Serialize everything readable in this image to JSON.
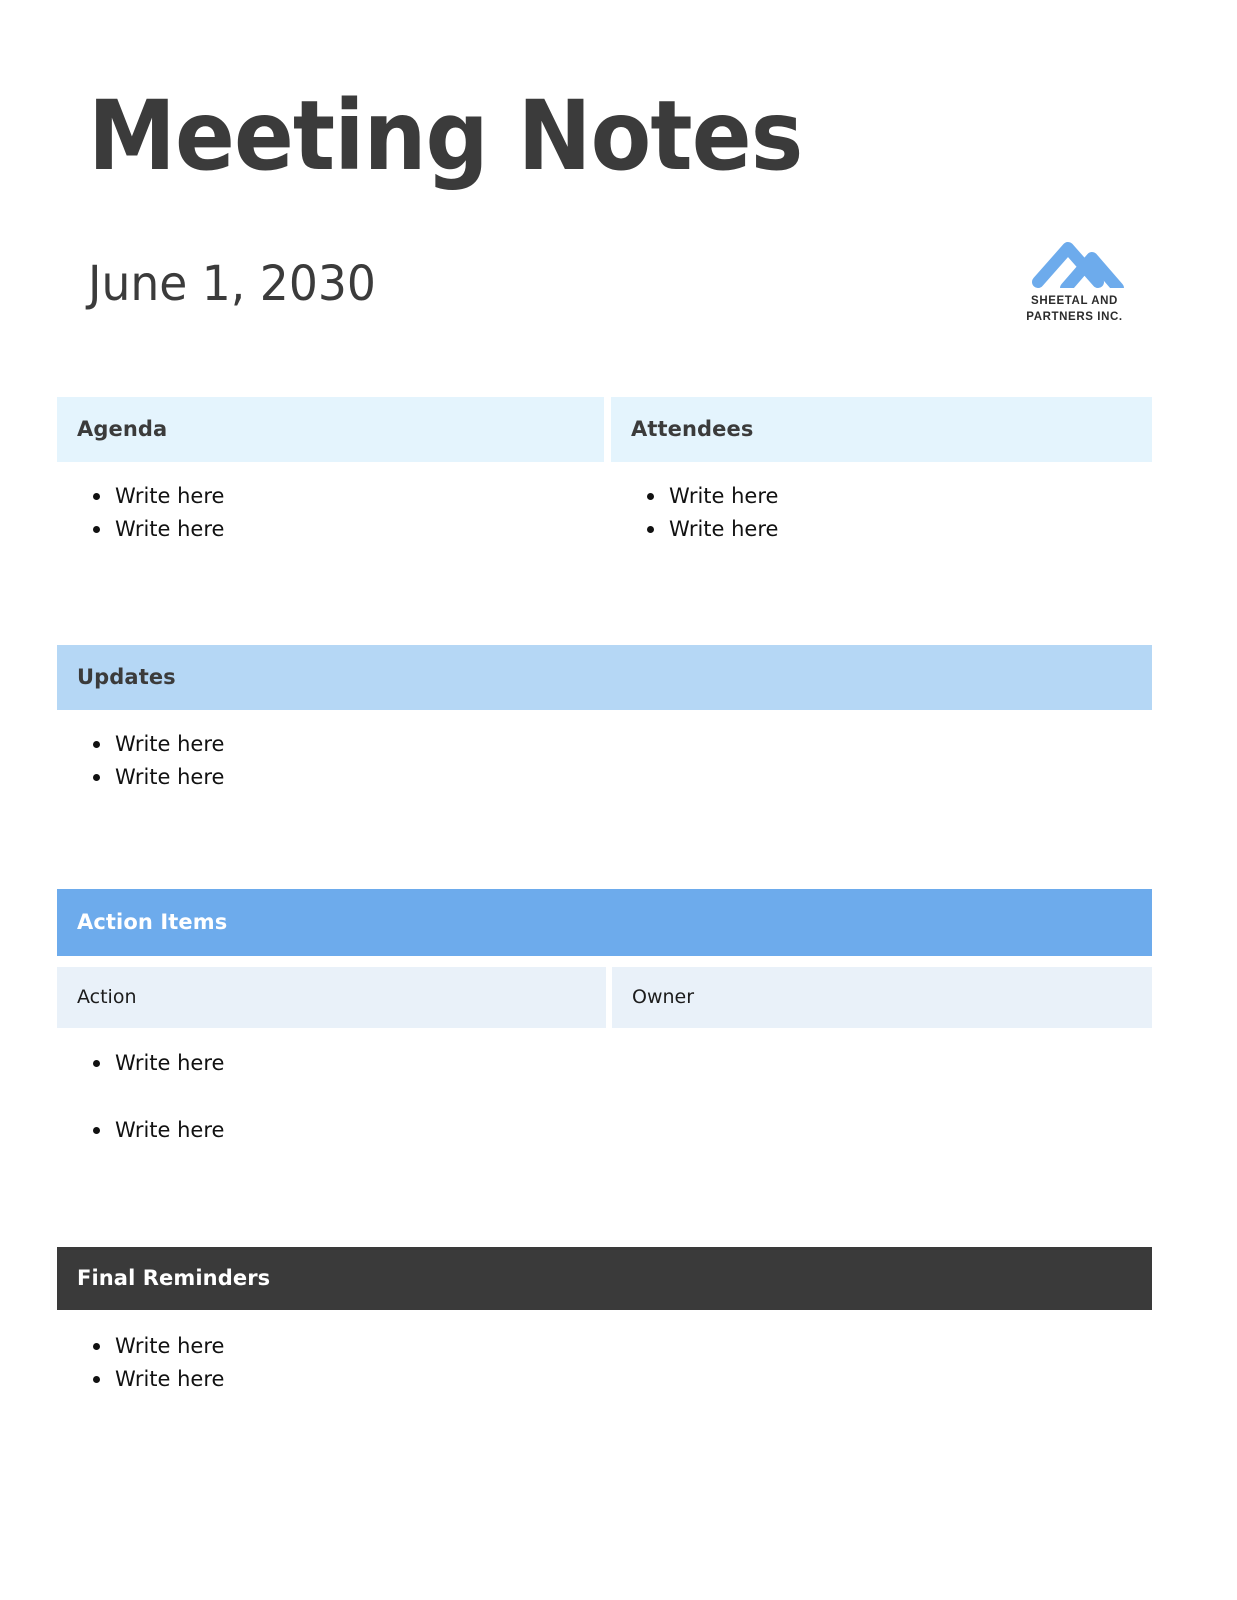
{
  "document": {
    "title": "Meeting Notes",
    "date": "June 1, 2030"
  },
  "logo": {
    "icon": "double-chevron-up-icon",
    "line1": "SHEETAL AND",
    "line2": "PARTNERS INC.",
    "color": "#6dabec"
  },
  "sections": {
    "agenda": {
      "heading": "Agenda",
      "items": [
        "Write here",
        "Write here"
      ]
    },
    "attendees": {
      "heading": "Attendees",
      "items": [
        "Write here",
        "Write here"
      ]
    },
    "updates": {
      "heading": "Updates",
      "items": [
        "Write here",
        "Write here"
      ]
    },
    "action_items": {
      "heading": "Action Items",
      "columns": [
        "Action",
        "Owner"
      ],
      "actions": [
        "Write here",
        "Write here"
      ],
      "owners": []
    },
    "final_reminders": {
      "heading": "Final Reminders",
      "items": [
        "Write here",
        "Write here"
      ]
    }
  },
  "colors": {
    "pale_blue": "#e4f4fd",
    "light_blue": "#b5d7f5",
    "accent_blue": "#6dabec",
    "subhead_blue": "#e9f1f9",
    "dark": "#3a3a3a"
  }
}
